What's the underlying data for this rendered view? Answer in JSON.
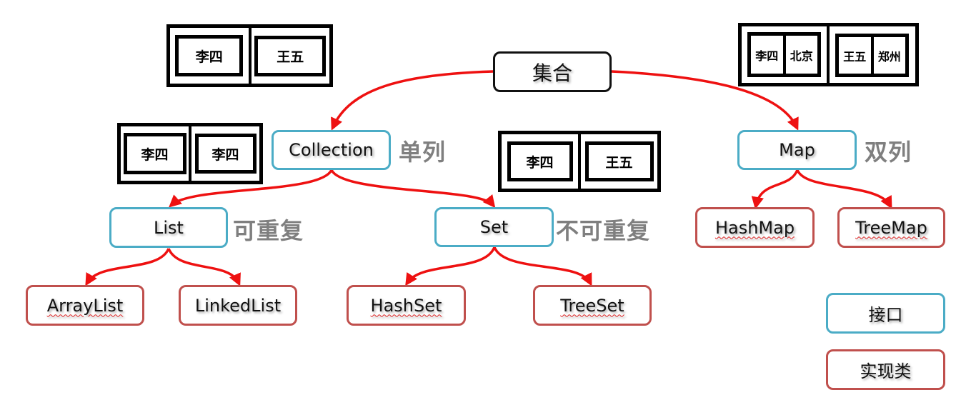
{
  "colors": {
    "arrow": "#ee1111",
    "interface_border": "#4bacc6",
    "impl_border": "#c0504d",
    "root_border": "#111111",
    "note_text": "#7f7f7f"
  },
  "root": {
    "label": "集合"
  },
  "interfaces": {
    "collection": {
      "label": "Collection",
      "note": "单列"
    },
    "map": {
      "label": "Map",
      "note": "双列"
    },
    "list": {
      "label": "List",
      "note": "可重复"
    },
    "set": {
      "label": "Set",
      "note": "不可重复"
    }
  },
  "implementations": {
    "arraylist": "ArrayList",
    "linkedlist": "LinkedList",
    "hashset": "HashSet",
    "treeset": "TreeSet",
    "hashmap": "HashMap",
    "treemap": "TreeMap"
  },
  "legend": {
    "interface": "接口",
    "implementation": "实现类"
  },
  "examples": {
    "top_left": [
      "李四",
      "王五"
    ],
    "collection_example": [
      "李四",
      "李四"
    ],
    "set_example": [
      "李四",
      "王五"
    ],
    "map_example": [
      {
        "key": "李四",
        "value": "北京"
      },
      {
        "key": "王五",
        "value": "郑州"
      }
    ]
  },
  "edges": [
    {
      "from": "集合",
      "to": "Collection"
    },
    {
      "from": "集合",
      "to": "Map"
    },
    {
      "from": "Collection",
      "to": "List"
    },
    {
      "from": "Collection",
      "to": "Set"
    },
    {
      "from": "List",
      "to": "ArrayList"
    },
    {
      "from": "List",
      "to": "LinkedList"
    },
    {
      "from": "Set",
      "to": "HashSet"
    },
    {
      "from": "Set",
      "to": "TreeSet"
    },
    {
      "from": "Map",
      "to": "HashMap"
    },
    {
      "from": "Map",
      "to": "TreeMap"
    }
  ]
}
